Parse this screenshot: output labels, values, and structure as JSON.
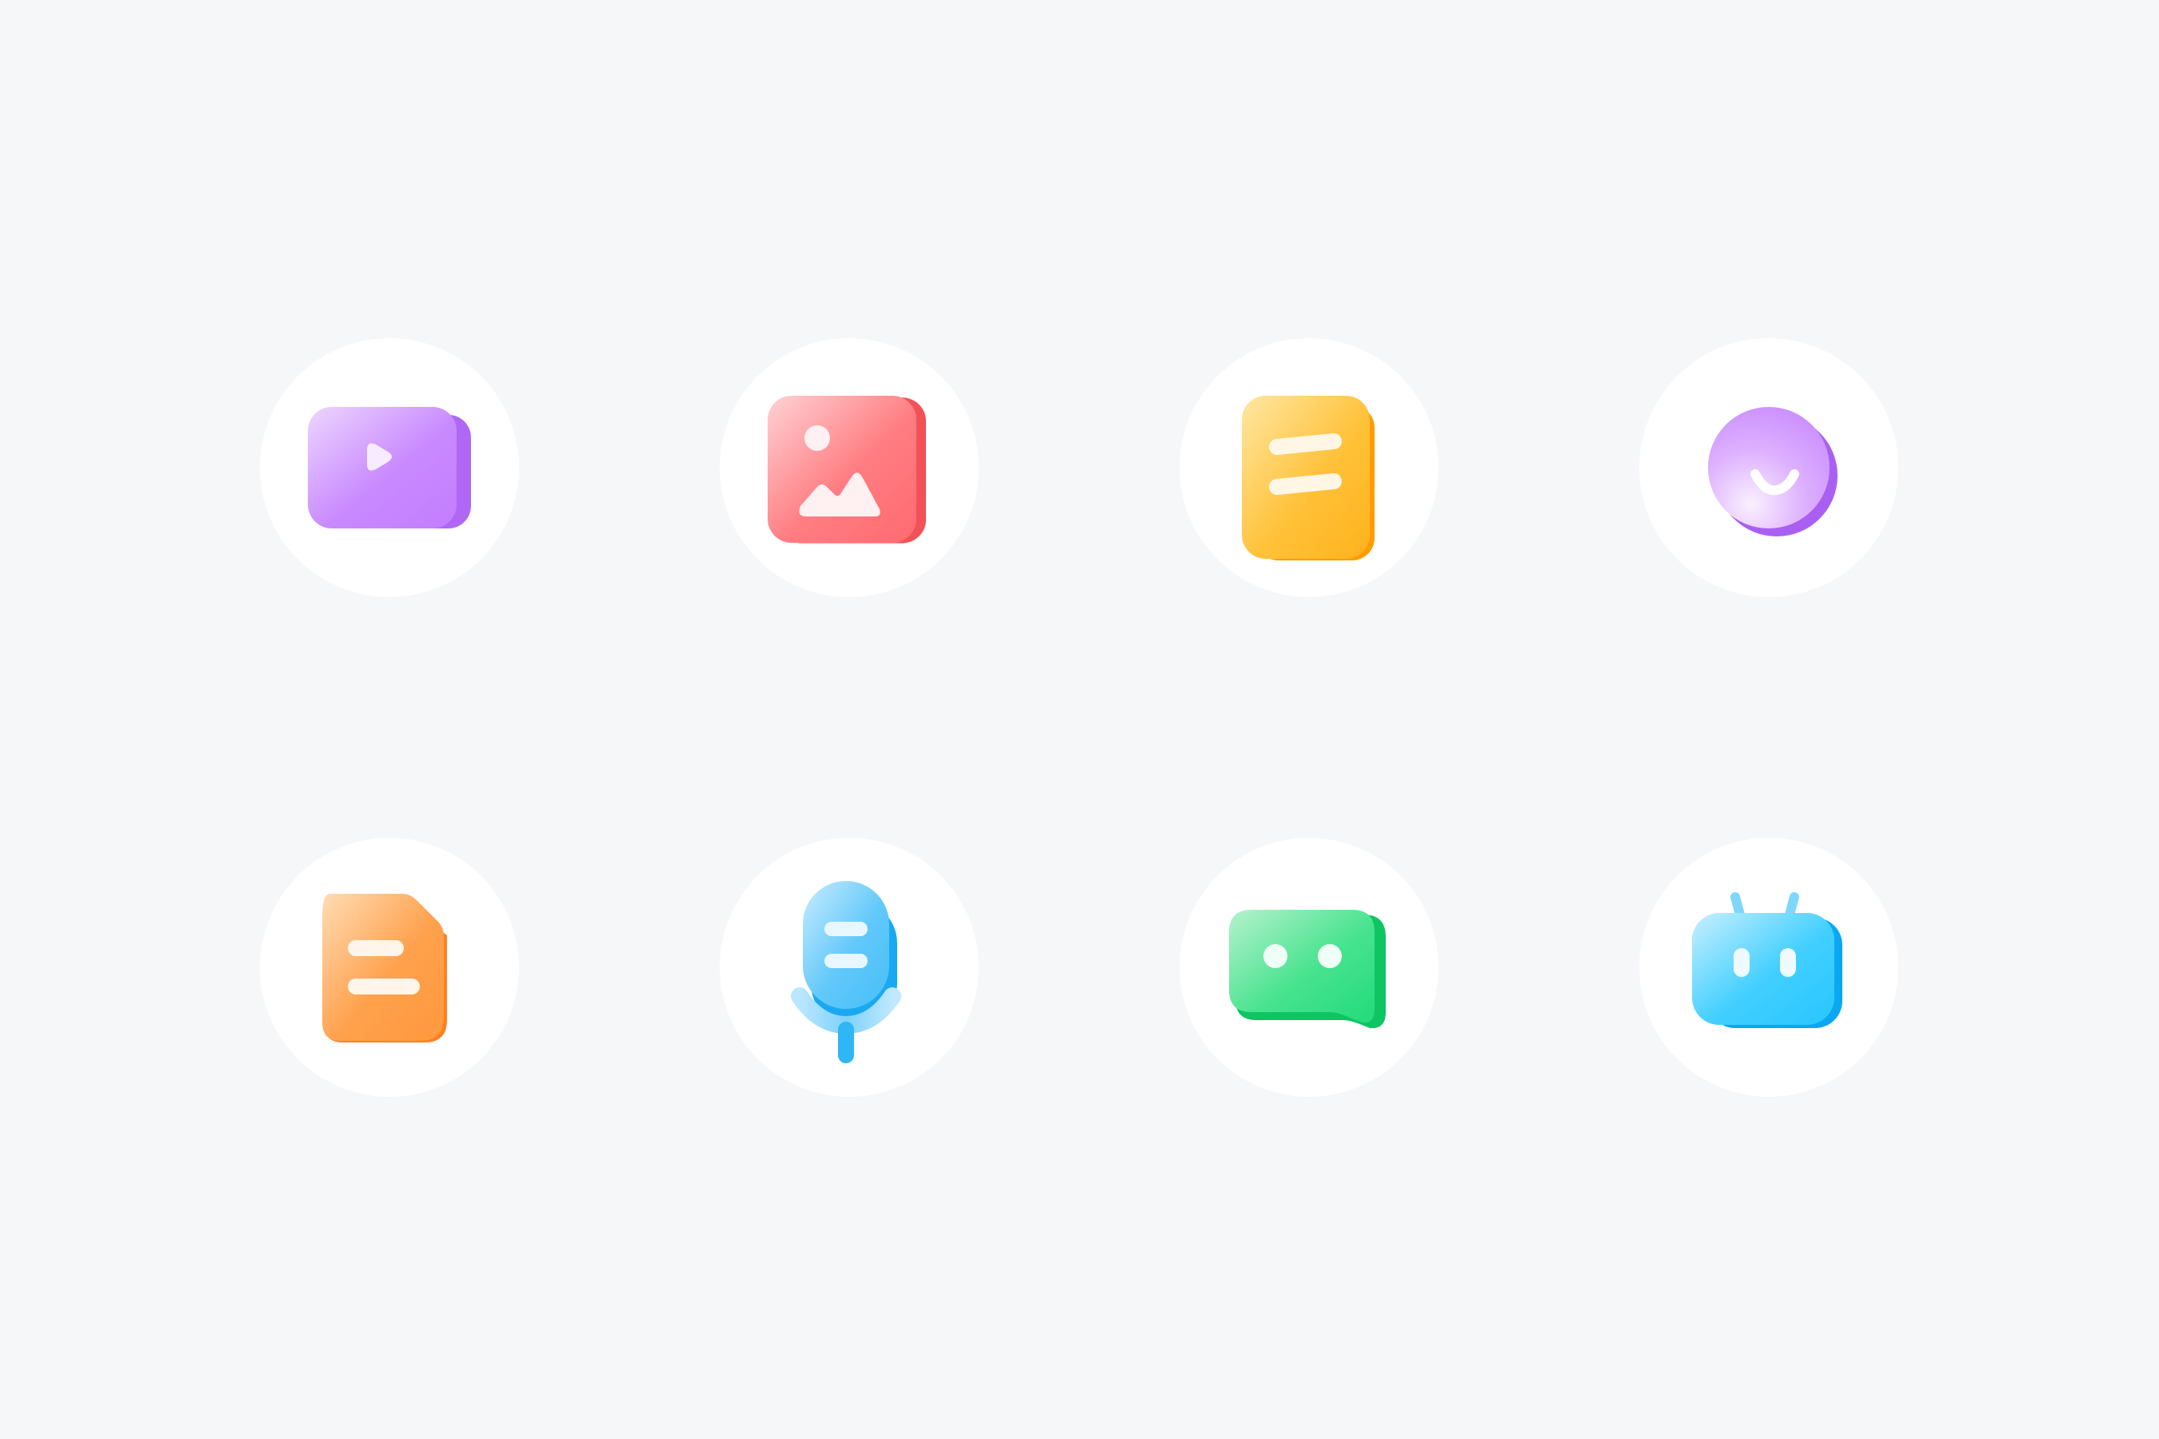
{
  "background_color": "#f6f7f9",
  "tile_color": "#ffffff",
  "icons": [
    {
      "name": "video-play-icon",
      "colors": [
        "#e7c9ff",
        "#c27dff",
        "#a760f0"
      ]
    },
    {
      "name": "image-gallery-icon",
      "colors": [
        "#ffc2c6",
        "#ff6b70",
        "#f25157"
      ]
    },
    {
      "name": "notes-icon",
      "colors": [
        "#ffe08f",
        "#ffb21c",
        "#ff9c00"
      ]
    },
    {
      "name": "smile-face-icon",
      "colors": [
        "#f3ddff",
        "#c98bff",
        "#a960f2"
      ]
    },
    {
      "name": "document-icon",
      "colors": [
        "#ffd6a8",
        "#ff983d",
        "#ff7f1f"
      ]
    },
    {
      "name": "microphone-icon",
      "colors": [
        "#bde8ff",
        "#46bff7",
        "#1aa9f1"
      ]
    },
    {
      "name": "chat-bubble-icon",
      "colors": [
        "#aef0c7",
        "#22db7b",
        "#0fc463"
      ]
    },
    {
      "name": "robot-icon",
      "colors": [
        "#b9ebff",
        "#28c6ff",
        "#0aa8f2"
      ]
    }
  ]
}
